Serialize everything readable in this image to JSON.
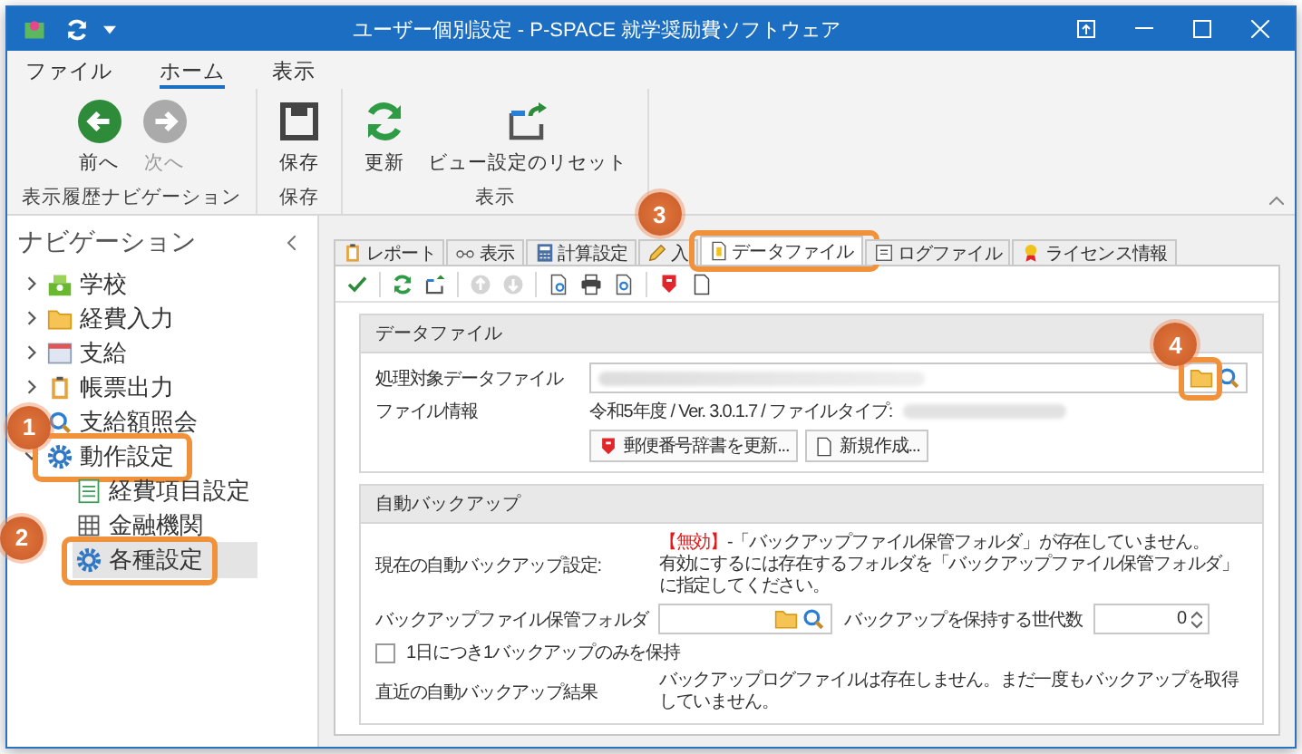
{
  "window": {
    "title": "ユーザー個別設定 - P-SPACE 就学奨励費ソフトウェア"
  },
  "menu": [
    {
      "label": "ファイル",
      "selected": false
    },
    {
      "label": "ホーム",
      "selected": true
    },
    {
      "label": "表示",
      "selected": false
    }
  ],
  "ribbon": [
    {
      "label": "表示履歴ナビゲーション",
      "buttons": [
        {
          "kind": "back",
          "label": "前へ",
          "disabled": false
        },
        {
          "kind": "forward",
          "label": "次へ",
          "disabled": true
        }
      ]
    },
    {
      "label": "保存",
      "buttons": [
        {
          "kind": "save",
          "label": "保存",
          "disabled": false
        }
      ]
    },
    {
      "label": "表示",
      "buttons": [
        {
          "kind": "refresh",
          "label": "更新",
          "disabled": false
        },
        {
          "kind": "reset",
          "label": "ビュー設定のリセット",
          "disabled": false
        }
      ]
    }
  ],
  "navigation": {
    "title": "ナビゲーション",
    "items": [
      {
        "label": "学校",
        "kind": "school",
        "expanded": false,
        "selected": false
      },
      {
        "label": "経費入力",
        "kind": "folder",
        "expanded": false,
        "selected": false
      },
      {
        "label": "支給",
        "kind": "calendar",
        "expanded": false,
        "selected": false
      },
      {
        "label": "帳票出力",
        "kind": "clipboard",
        "expanded": false,
        "selected": false
      },
      {
        "label": "支給額照会",
        "kind": "search",
        "selected": false
      },
      {
        "label": "動作設定",
        "kind": "gear",
        "expanded": true,
        "selected": false,
        "callout": "1",
        "children": [
          {
            "label": "経費項目設定",
            "kind": "sheet",
            "selected": false
          },
          {
            "label": "金融機関",
            "kind": "bank",
            "selected": false
          },
          {
            "label": "各種設定",
            "kind": "gear",
            "selected": true,
            "callout": "2"
          }
        ]
      }
    ]
  },
  "tabs": [
    {
      "label": "レポート",
      "kind": "clipboard",
      "selected": false
    },
    {
      "label": "表示",
      "kind": "glasses",
      "selected": false
    },
    {
      "label": "計算設定",
      "kind": "calc",
      "selected": false
    },
    {
      "label": "入",
      "kind": "pencil",
      "selected": false
    },
    {
      "label": "データファイル",
      "kind": "doc",
      "selected": true,
      "callout": "3"
    },
    {
      "label": "ログファイル",
      "kind": "log",
      "selected": false
    },
    {
      "label": "ライセンス情報",
      "kind": "award",
      "selected": false
    }
  ],
  "toolbar": [
    {
      "kind": "check",
      "disabled": false
    },
    {
      "kind": "refresh",
      "disabled": false
    },
    {
      "kind": "export",
      "disabled": false
    },
    {
      "kind": "up",
      "disabled": true
    },
    {
      "kind": "down",
      "disabled": true
    },
    {
      "kind": "docsearch",
      "disabled": false
    },
    {
      "kind": "print",
      "disabled": false
    },
    {
      "kind": "preview",
      "disabled": false
    },
    {
      "kind": "marker",
      "disabled": false
    },
    {
      "kind": "blank",
      "disabled": false
    }
  ],
  "data_file": {
    "title": "データファイル",
    "target_label": "処理対象データファイル",
    "browse_callout": "4",
    "info_label": "ファイル情報",
    "info": "令和5年度 / Ver. 3.0.1.7 / ファイルタイプ:",
    "buttons": [
      {
        "kind": "marker",
        "label": "郵便番号辞書を更新..."
      },
      {
        "kind": "blank",
        "label": "新規作成..."
      }
    ]
  },
  "auto_backup": {
    "title": "自動バックアップ",
    "current_label": "現在の自動バックアップ設定:",
    "status": "【無効】",
    "message": "-「バックアップファイル保管フォルダ」が存在していません。",
    "hint": "有効にするには存在するフォルダを「バックアップファイル保管フォルダ」に指定してください。",
    "folder_label": "バックアップファイル保管フォルダ",
    "generations_label": "バックアップを保持する世代数",
    "generations": "0",
    "daily_only": {
      "label": "1日につき1バックアップのみを保持",
      "checked": false
    },
    "result_label": "直近の自動バックアップ結果",
    "result": "バックアップログファイルは存在しません。まだ一度もバックアップを取得していません。"
  }
}
